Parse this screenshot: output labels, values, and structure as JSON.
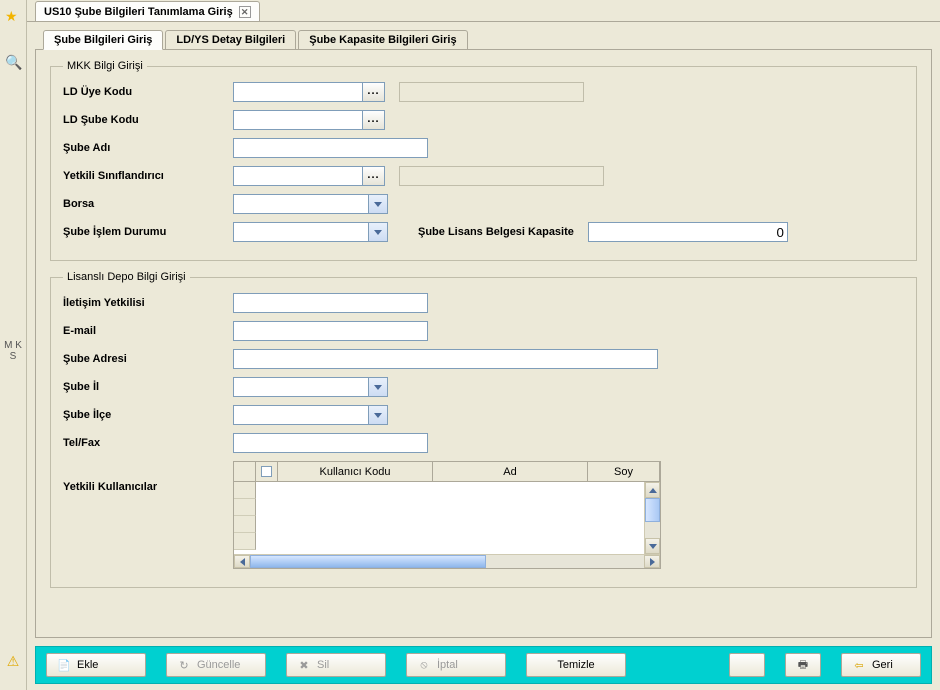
{
  "window": {
    "title": "US10 Şube Bilgileri Tanımlama Giriş"
  },
  "side": {
    "mks": "M\nK\nS"
  },
  "tabs": {
    "items": [
      {
        "label": "Şube Bilgileri Giriş"
      },
      {
        "label": "LD/YS Detay Bilgileri"
      },
      {
        "label": "Şube Kapasite Bilgileri Giriş"
      }
    ]
  },
  "mkk": {
    "legend": "MKK Bilgi Girişi",
    "ld_uye_kodu_label": "LD Üye Kodu",
    "ld_uye_kodu_value": "",
    "ld_uye_kodu_display": "",
    "ld_sube_kodu_label": "LD Şube Kodu",
    "ld_sube_kodu_value": "",
    "sube_adi_label": "Şube Adı",
    "sube_adi_value": "",
    "yetkili_label": "Yetkili Sınıflandırıcı",
    "yetkili_value": "",
    "yetkili_display": "",
    "borsa_label": "Borsa",
    "borsa_value": "",
    "durum_label": "Şube İşlem Durumu",
    "durum_value": "",
    "kapasite_label": "Şube Lisans Belgesi Kapasite",
    "kapasite_value": "0"
  },
  "depo": {
    "legend": "Lisanslı Depo Bilgi Girişi",
    "iletisim_label": "İletişim Yetkilisi",
    "iletisim_value": "",
    "email_label": "E-mail",
    "email_value": "",
    "adres_label": "Şube Adresi",
    "adres_value": "",
    "il_label": "Şube İl",
    "il_value": "",
    "ilce_label": "Şube İlçe",
    "ilce_value": "",
    "telfax_label": "Tel/Fax",
    "telfax_value": "",
    "yetkili_kullanicilar_label": "Yetkili Kullanıcılar",
    "grid": {
      "columns": [
        "Kullanıcı Kodu",
        "Ad",
        "Soy"
      ]
    }
  },
  "buttons": {
    "ekle": "Ekle",
    "guncelle": "Güncelle",
    "sil": "Sil",
    "iptal": "İptal",
    "temizle": "Temizle",
    "geri": "Geri"
  }
}
